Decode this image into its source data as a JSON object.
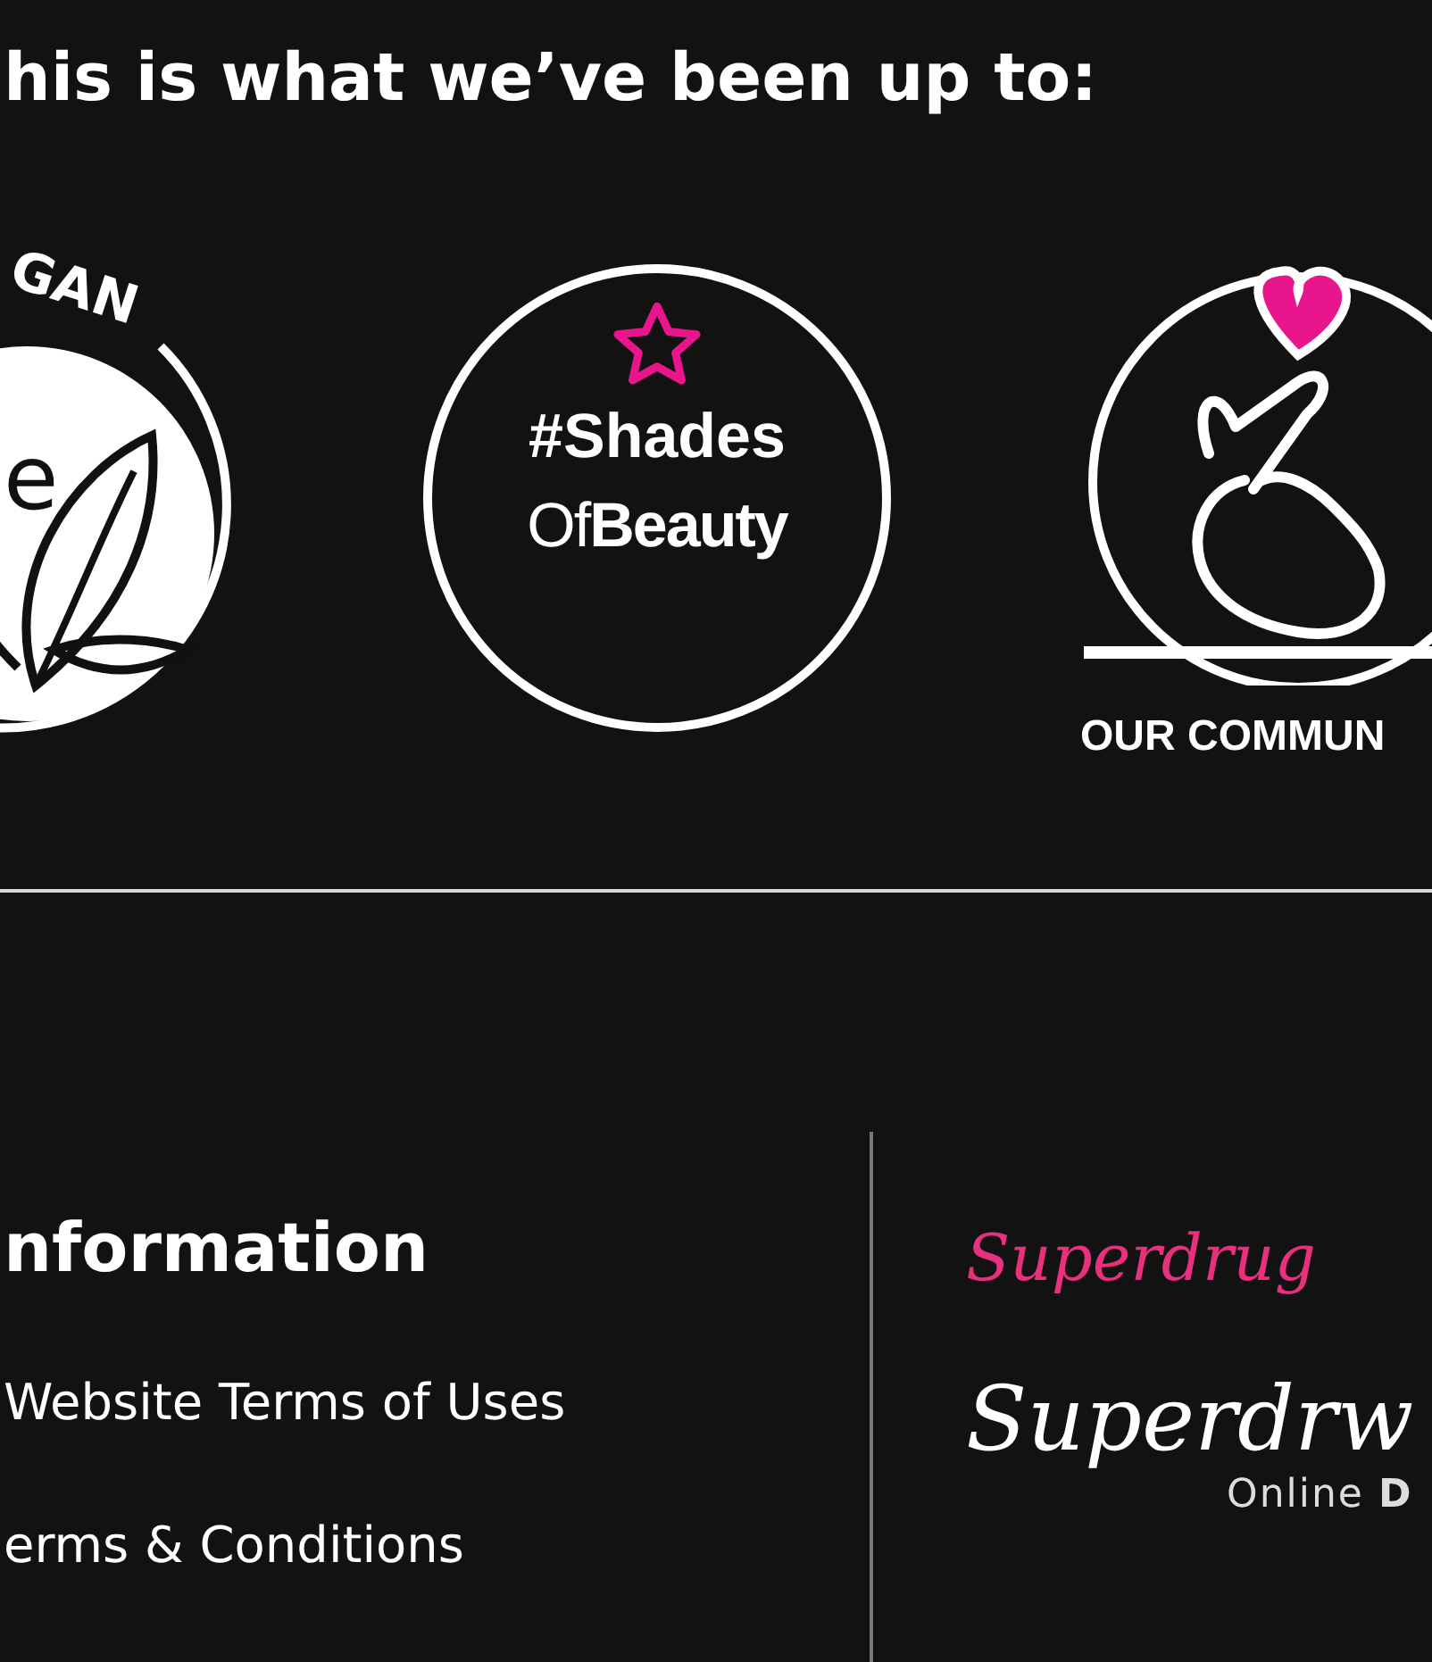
{
  "heading": "his is what we’ve been up to:",
  "badges": [
    {
      "kind": "vegan",
      "arc_text": "GAN",
      "letter": "e"
    },
    {
      "kind": "shades",
      "line_1": "#Shades",
      "line_2": "Of**Beauty**"
    },
    {
      "kind": "community",
      "caption": "OUR COMMUN"
    }
  ],
  "footer": {
    "info_title": "nformation",
    "links": [
      "Website Terms of Uses",
      "erms & Conditions"
    ],
    "logos": [
      {
        "kind": "pink",
        "text": "Superdrug"
      },
      {
        "kind": "white",
        "text": "Superdrw",
        "subtitle": "Online **D**"
      }
    ]
  }
}
